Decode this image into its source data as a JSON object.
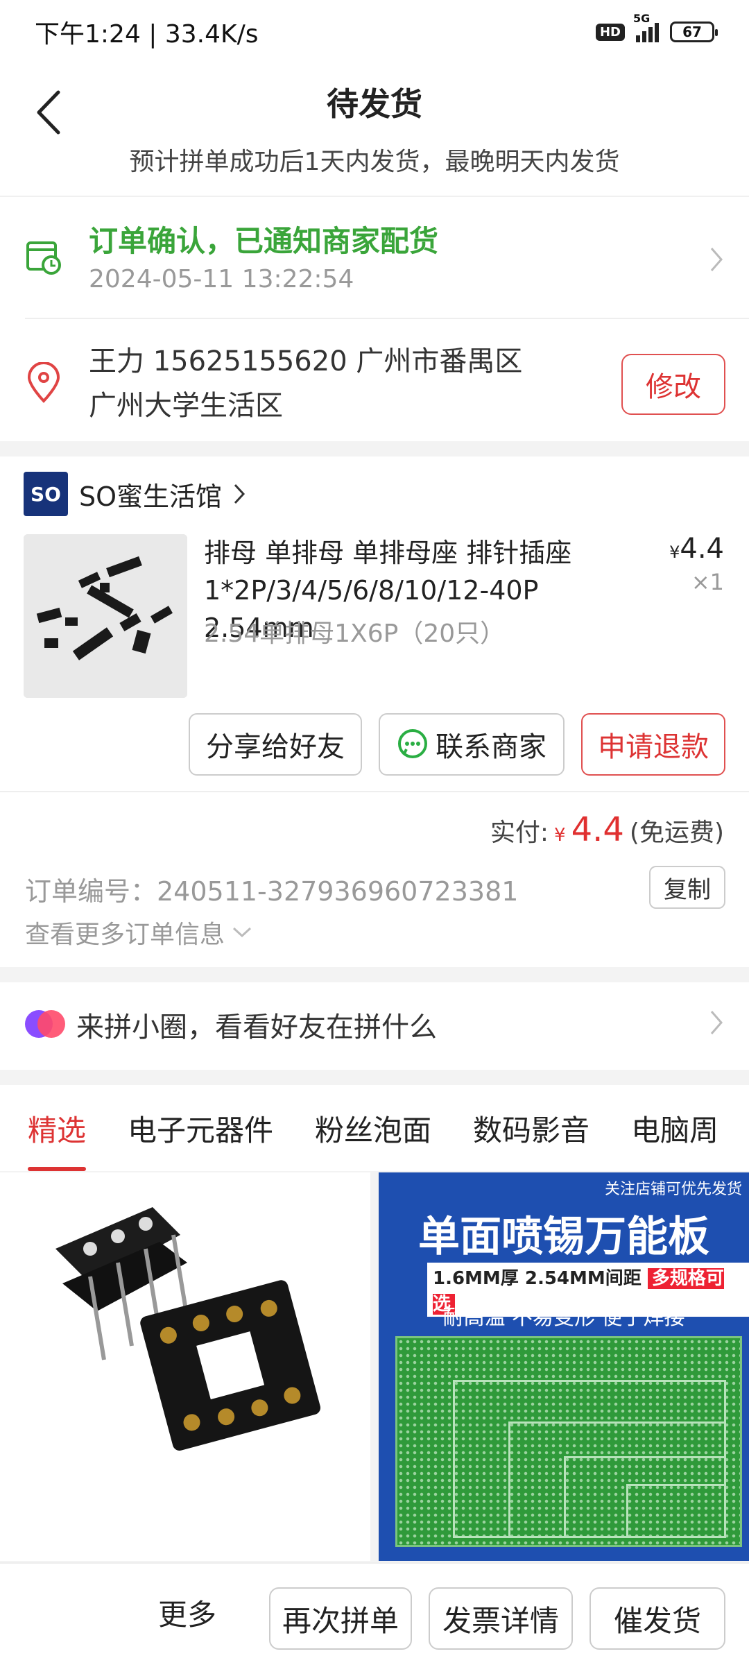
{
  "status_bar": {
    "time_speed": "下午1:24 | 33.4K/s",
    "hd": "HD",
    "network": "5G",
    "battery": "67"
  },
  "header": {
    "title": "待发货",
    "subtitle": "预计拼单成功后1天内发货，最晚明天内发货"
  },
  "order_status": {
    "text": "订单确认，已通知商家配货",
    "time": "2024-05-11 13:22:54"
  },
  "address": {
    "line1": "王力  15625155620  广州市番禺区",
    "line2": "广州大学生活区",
    "edit_label": "修改"
  },
  "shop": {
    "logo": "SO",
    "name": "SO蜜生活馆"
  },
  "product": {
    "name": "排母 单排母 单排母座 排针插座1*2P/3/4/5/6/8/10/12-40P 2.54mm",
    "currency": "¥",
    "price": "4.4",
    "qty": "×1",
    "spec": "2.54单排母1X6P（20只）"
  },
  "actions": {
    "share": "分享给好友",
    "contact": "联系商家",
    "refund": "申请退款"
  },
  "payment": {
    "label": "实付:",
    "currency": "¥",
    "amount": "4.4",
    "note": "(免运费)"
  },
  "order_info": {
    "number": "订单编号：240511-327936960723381",
    "copy": "复制",
    "more": "查看更多订单信息"
  },
  "circle_banner": {
    "text": "来拼小圈，看看好友在拼什么"
  },
  "tabs": [
    "精选",
    "电子元器件",
    "粉丝泡面",
    "数码影音",
    "电脑周"
  ],
  "grid": {
    "pcb_ad": {
      "top_note": "关注店铺可优先发货",
      "title": "单面喷锡万能板",
      "spec": "1.6MM厚 2.54MM间距",
      "spec_highlight": "多规格可选",
      "features": "耐高温  不易变形  便于焊接"
    }
  },
  "bottom_bar": {
    "more": "更多",
    "rebuy": "再次拼单",
    "invoice": "发票详情",
    "urge": "催发货"
  },
  "colors": {
    "accent_red": "#d33333",
    "success_green": "#3aa53a",
    "shop_blue": "#17337a"
  }
}
